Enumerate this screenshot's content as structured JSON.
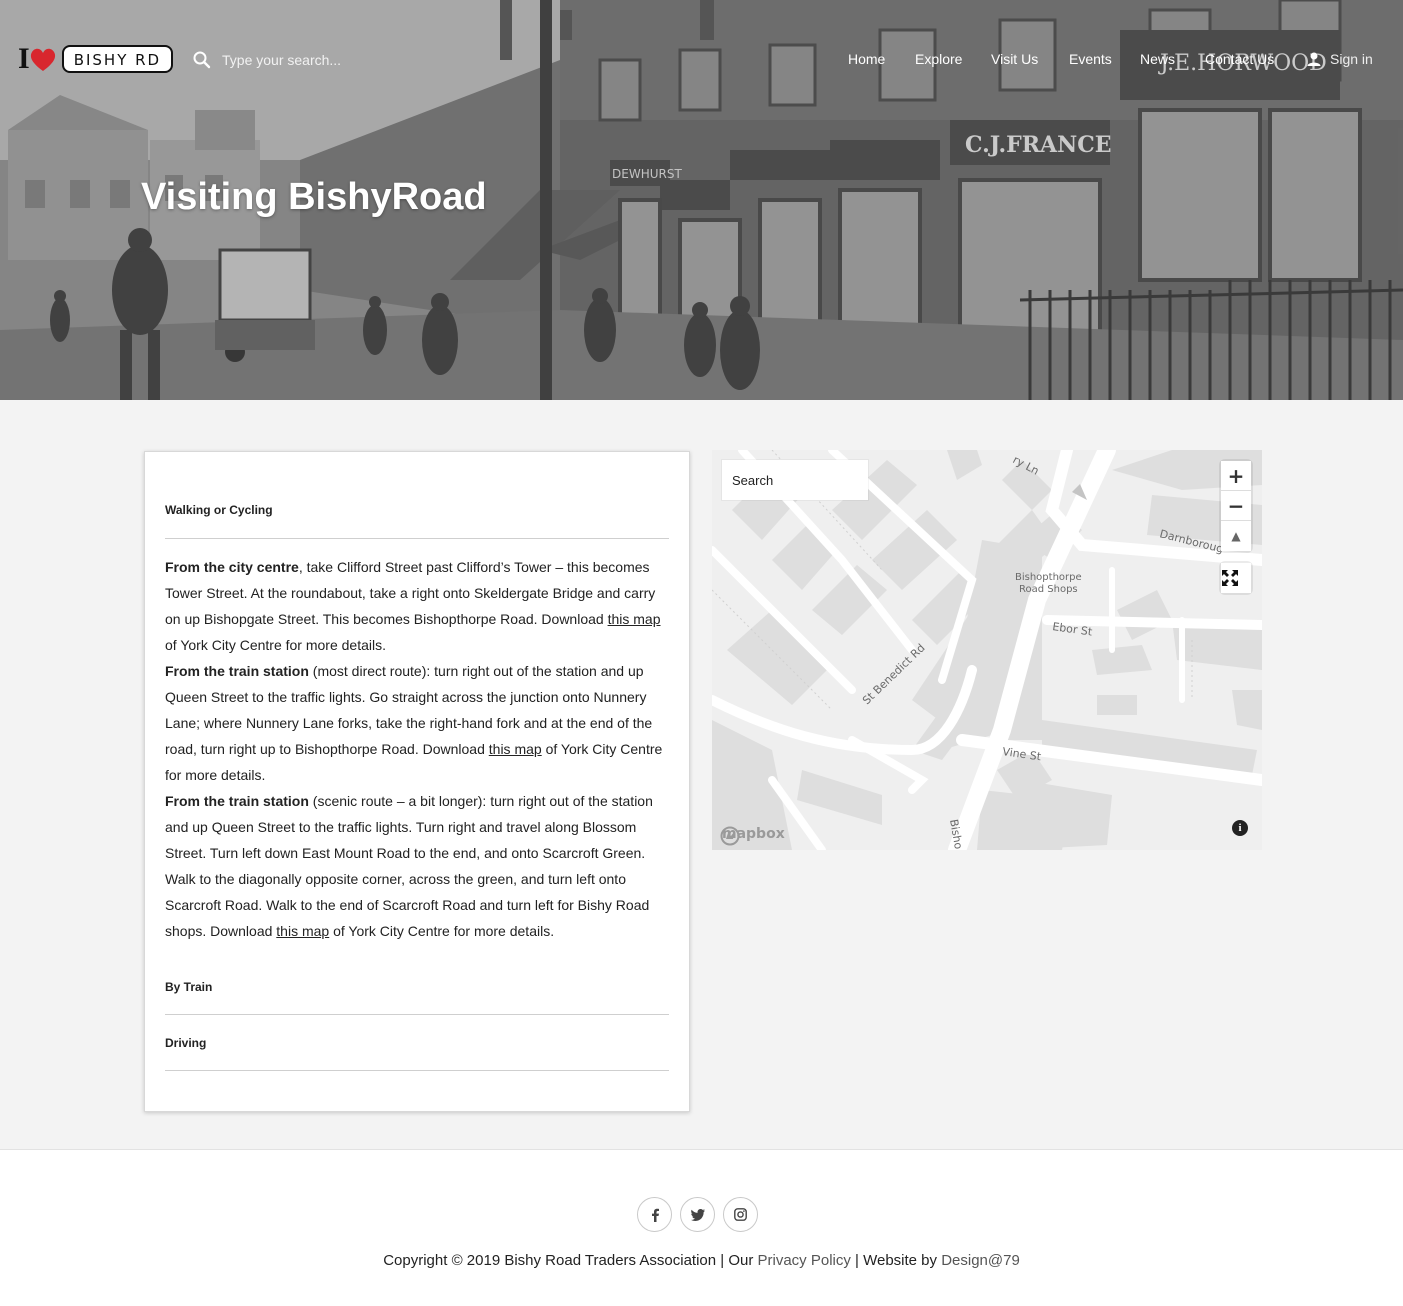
{
  "header": {
    "logo_i": "I",
    "logo_plate": "BISHY RD",
    "search_placeholder": "Type your search...",
    "nav": {
      "home": "Home",
      "explore": "Explore",
      "visit": "Visit Us",
      "events": "Events",
      "news": "News",
      "contact": "Contact Us",
      "signin": "Sign in"
    }
  },
  "hero": {
    "title": "Visiting BishyRoad",
    "shop_signs": [
      "DEWHURST",
      "C.J.FRANCE",
      "J.E.HORWOOD"
    ]
  },
  "directions": {
    "walking": {
      "heading": "Walking or Cycling",
      "p1_bold": "From the city centre",
      "p1_text": ", take Clifford Street past Clifford’s Tower – this becomes Tower Street. At the roundabout, take a right onto Skeldergate Bridge and carry on up Bishopgate Street. This becomes Bishopthorpe Road. Download ",
      "p1_link": "this map",
      "p1_end": " of York City Centre for more details.",
      "p2_bold": "From the train station",
      "p2_text": " (most direct route): turn right out of the station and up Queen Street to the traffic lights. Go straight across the junction onto Nunnery Lane; where Nunnery Lane forks, take the right-hand fork and at the end of the road, turn right up to Bishopthorpe Road. Download ",
      "p2_link": "this map",
      "p2_end": " of York City Centre for more details.",
      "p3_bold": "From the train station",
      "p3_text": " (scenic route – a bit longer): turn right out of the station and up Queen Street to the traffic lights. Turn right and travel along Blossom Street. Turn left down East Mount Road to the end, and onto Scarcroft Green. Walk to the diagonally opposite corner, across the green, and turn left onto Scarcroft Road. Walk to the end of Scarcroft Road and turn left for Bishy Road shops. Download ",
      "p3_link": "this map",
      "p3_end": " of York City Centre for more details."
    },
    "train": {
      "heading": "By Train"
    },
    "driving": {
      "heading": "Driving"
    }
  },
  "map": {
    "search_placeholder": "Search",
    "zoom_in": "+",
    "zoom_out": "−",
    "compass": "▲",
    "labels": {
      "ln": "ry Ln",
      "darnborough": "Darnboroug",
      "shops_line1": "Bishopthorpe",
      "shops_line2": "Road Shops",
      "ebor": "Ebor St",
      "benedict": "St Benedict Rd",
      "vine": "Vine St",
      "bisho": "Bisho"
    },
    "attribution_logo": "mapbox",
    "info": "i"
  },
  "footer": {
    "copyright_text": "Copyright © 2019 Bishy Road Traders Association | Our ",
    "privacy_link": "Privacy Policy",
    "mid_text": " | Website by ",
    "designer_link": "Design@79"
  },
  "colors": {
    "page_bg": "#f3f3f3",
    "card_bg": "#ffffff",
    "footer_link": "#555555",
    "heart": "#d8272e"
  }
}
